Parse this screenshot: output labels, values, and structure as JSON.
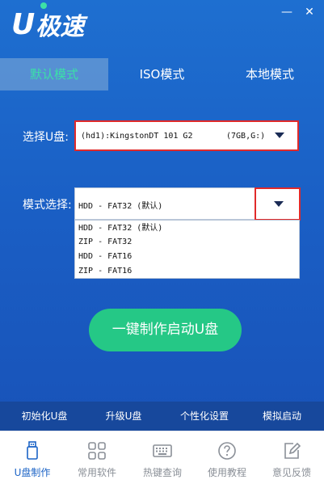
{
  "app": {
    "logo_u": "U",
    "logo_text": "极速",
    "minimize_glyph": "—",
    "close_glyph": "✕"
  },
  "tabs": [
    {
      "label": "默认模式",
      "active": true
    },
    {
      "label": "ISO模式",
      "active": false
    },
    {
      "label": "本地模式",
      "active": false
    }
  ],
  "form": {
    "udisk_label": "选择U盘:",
    "udisk_name": "(hd1):KingstonDT 101 G2",
    "udisk_size": "(7GB,G:)",
    "mode_label": "模式选择:",
    "mode_value": "HDD - FAT32 (默认)",
    "mode_options": [
      "HDD - FAT32 (默认)",
      "ZIP - FAT32",
      "HDD - FAT16",
      "ZIP - FAT16"
    ]
  },
  "make_button": "一键制作启动U盘",
  "subbar": [
    "初始化U盘",
    "升级U盘",
    "个性化设置",
    "模拟启动"
  ],
  "bottom_nav": [
    {
      "label": "U盘制作",
      "icon": "usb-drive-icon",
      "active": true
    },
    {
      "label": "常用软件",
      "icon": "apps-grid-icon",
      "active": false
    },
    {
      "label": "热键查询",
      "icon": "keyboard-icon",
      "active": false
    },
    {
      "label": "使用教程",
      "icon": "help-circle-icon",
      "active": false
    },
    {
      "label": "意见反馈",
      "icon": "edit-feedback-icon",
      "active": false
    }
  ],
  "colors": {
    "accent_green": "#25c886",
    "active_tab_text": "#3be0a7",
    "highlight_red": "#e02a2a",
    "nav_active": "#1b63c6"
  }
}
